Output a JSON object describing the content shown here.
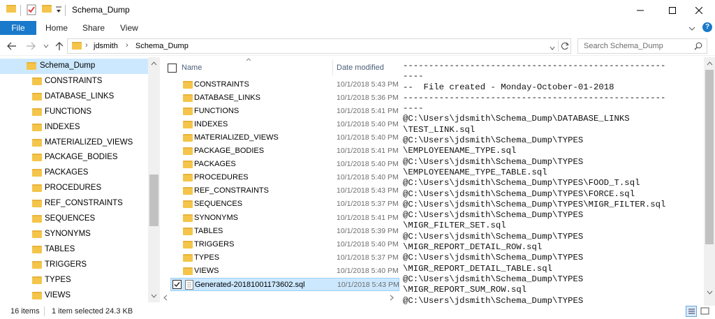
{
  "window": {
    "title": "Schema_Dump"
  },
  "ribbon": {
    "tabs": [
      "File",
      "Home",
      "Share",
      "View"
    ]
  },
  "address": {
    "crumbs": [
      "jdsmith",
      "Schema_Dump"
    ],
    "search_placeholder": "Search Schema_Dump"
  },
  "nav": {
    "items": [
      "Schema_Dump",
      "CONSTRAINTS",
      "DATABASE_LINKS",
      "FUNCTIONS",
      "INDEXES",
      "MATERIALIZED_VIEWS",
      "PACKAGE_BODIES",
      "PACKAGES",
      "PROCEDURES",
      "REF_CONSTRAINTS",
      "SEQUENCES",
      "SYNONYMS",
      "TABLES",
      "TRIGGERS",
      "TYPES",
      "VIEWS"
    ]
  },
  "filelist": {
    "columns": {
      "name": "Name",
      "date": "Date modified"
    },
    "rows": [
      {
        "name": "CONSTRAINTS",
        "date": "10/1/2018 5:43 PM"
      },
      {
        "name": "DATABASE_LINKS",
        "date": "10/1/2018 5:36 PM"
      },
      {
        "name": "FUNCTIONS",
        "date": "10/1/2018 5:41 PM"
      },
      {
        "name": "INDEXES",
        "date": "10/1/2018 5:40 PM"
      },
      {
        "name": "MATERIALIZED_VIEWS",
        "date": "10/1/2018 5:40 PM"
      },
      {
        "name": "PACKAGE_BODIES",
        "date": "10/1/2018 5:41 PM"
      },
      {
        "name": "PACKAGES",
        "date": "10/1/2018 5:40 PM"
      },
      {
        "name": "PROCEDURES",
        "date": "10/1/2018 5:40 PM"
      },
      {
        "name": "REF_CONSTRAINTS",
        "date": "10/1/2018 5:43 PM"
      },
      {
        "name": "SEQUENCES",
        "date": "10/1/2018 5:37 PM"
      },
      {
        "name": "SYNONYMS",
        "date": "10/1/2018 5:41 PM"
      },
      {
        "name": "TABLES",
        "date": "10/1/2018 5:39 PM"
      },
      {
        "name": "TRIGGERS",
        "date": "10/1/2018 5:40 PM"
      },
      {
        "name": "TYPES",
        "date": "10/1/2018 5:37 PM"
      },
      {
        "name": "VIEWS",
        "date": "10/1/2018 5:40 PM"
      },
      {
        "name": "Generated-20181001173602.sql",
        "date": "10/1/2018 5:43 PM"
      }
    ]
  },
  "preview": {
    "text": "---------------------------------------------------\n----\n--  File created - Monday-October-01-2018\n---------------------------------------------------\n----\n@C:\\Users\\jdsmith\\Schema_Dump\\DATABASE_LINKS\n\\TEST_LINK.sql\n@C:\\Users\\jdsmith\\Schema_Dump\\TYPES\n\\EMPLOYEENAME_TYPE.sql\n@C:\\Users\\jdsmith\\Schema_Dump\\TYPES\n\\EMPLOYEENAME_TYPE_TABLE.sql\n@C:\\Users\\jdsmith\\Schema_Dump\\TYPES\\FOOD_T.sql\n@C:\\Users\\jdsmith\\Schema_Dump\\TYPES\\FORCE.sql\n@C:\\Users\\jdsmith\\Schema_Dump\\TYPES\\MIGR_FILTER.sql\n@C:\\Users\\jdsmith\\Schema_Dump\\TYPES\n\\MIGR_FILTER_SET.sql\n@C:\\Users\\jdsmith\\Schema_Dump\\TYPES\n\\MIGR_REPORT_DETAIL_ROW.sql\n@C:\\Users\\jdsmith\\Schema_Dump\\TYPES\n\\MIGR_REPORT_DETAIL_TABLE.sql\n@C:\\Users\\jdsmith\\Schema_Dump\\TYPES\n\\MIGR_REPORT_SUM_ROW.sql\n@C:\\Users\\jdsmith\\Schema_Dump\\TYPES"
  },
  "status": {
    "count": "16 items",
    "selected": "1 item selected  24.3 KB"
  },
  "colors": {
    "accent": "#1979ca",
    "selection": "#cce8ff",
    "folder": "#f4c54a"
  }
}
